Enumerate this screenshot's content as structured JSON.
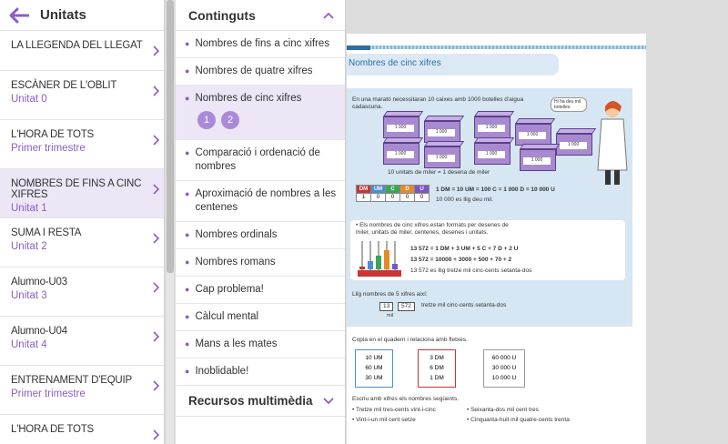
{
  "units_panel": {
    "title": "Unitats",
    "items": [
      {
        "title": "LA LLEGENDA DEL LLEGAT",
        "subtitle": ""
      },
      {
        "title": "ESCÀNER DE L'OBLIT",
        "subtitle": "Unitat 0"
      },
      {
        "title": "L'HORA DE TOTS",
        "subtitle": "Primer trimestre"
      },
      {
        "title": "NOMBRES DE FINS A CINC XIFRES",
        "subtitle": "Unitat 1"
      },
      {
        "title": "SUMA I RESTA",
        "subtitle": "Unitat 2"
      },
      {
        "title": "Alumno-U03",
        "subtitle": "Unitat 3"
      },
      {
        "title": "Alumno-U04",
        "subtitle": "Unitat 4"
      },
      {
        "title": "ENTRENAMENT D'EQUIP",
        "subtitle": "Primer trimestre"
      },
      {
        "title": "L'HORA DE TOTS",
        "subtitle": ""
      }
    ],
    "active_index": 3
  },
  "contents_panel": {
    "title": "Continguts",
    "items": [
      "Nombres de fins a cinc xifres",
      "Nombres de quatre xifres",
      "Nombres de cinc xifres",
      "Comparació i ordenació de nombres",
      "Aproximació de nombres a les centenes",
      "Nombres ordinals",
      "Nombres romans",
      "Cap problema!",
      "Càlcul mental",
      "Mans a les mates",
      "Inoblidable!"
    ],
    "active_index": 2,
    "pages": [
      "1",
      "2"
    ],
    "resources_title": "Recursos multimèdia"
  },
  "book_page": {
    "title": "Nombres de cinc xifres",
    "intro": "En una marató necessitaran 10 caixes amb 1000 botelles d'aigua cadascuna.",
    "speech": "Hi ha deu mil botelles.",
    "crate_label": "1 000",
    "caption": "10 unitats de miler = 1 desena de miler",
    "table_headers": [
      "DM",
      "UM",
      "C",
      "D",
      "U"
    ],
    "table_values": [
      "1",
      "0",
      "0",
      "0",
      "0"
    ],
    "eq1": "1 DM = 10 UM = 100 C = 1 000 D = 10 000 U",
    "eq2": "10 000 es llig deu mil.",
    "bullet": "• Els nombres de cinc xifres estan formats per desenes de miler, unitats de miler, centenes, desenes i unitats.",
    "line1": "13 572 = 1 DM + 3 UM + 5 C + 7 D + 2 U",
    "line2": "13 572 = 10000 + 3000 + 500 + 70 + 2",
    "line3": "13 572 es llig tretze mil cinc-cents setanta-dos",
    "read_title": "Llig nombres de 5 xifres així:",
    "read_parts": [
      "13",
      "572"
    ],
    "read_arrow": "tretze mil cinc-cents setanta-dos",
    "read_mil": "mil",
    "ex1": "Copia en el quadern i relaciona amb fletxes.",
    "box1": [
      "10 UM",
      "60 UM",
      "30 UM"
    ],
    "box2": [
      "3 DM",
      "6 DM",
      "1 DM"
    ],
    "box3": [
      "60 000 U",
      "30 000 U",
      "10 000 U"
    ],
    "ex2": "Escriu amb xifres els nombres següents.",
    "list": [
      "• Tretze mil tres-cents vint-i-cinc",
      "• Vint-i-un mil cent setze",
      "• Seixanta-dos mil cent tres",
      "• Cinquanta-huit mil quatre-cents trenta"
    ]
  }
}
